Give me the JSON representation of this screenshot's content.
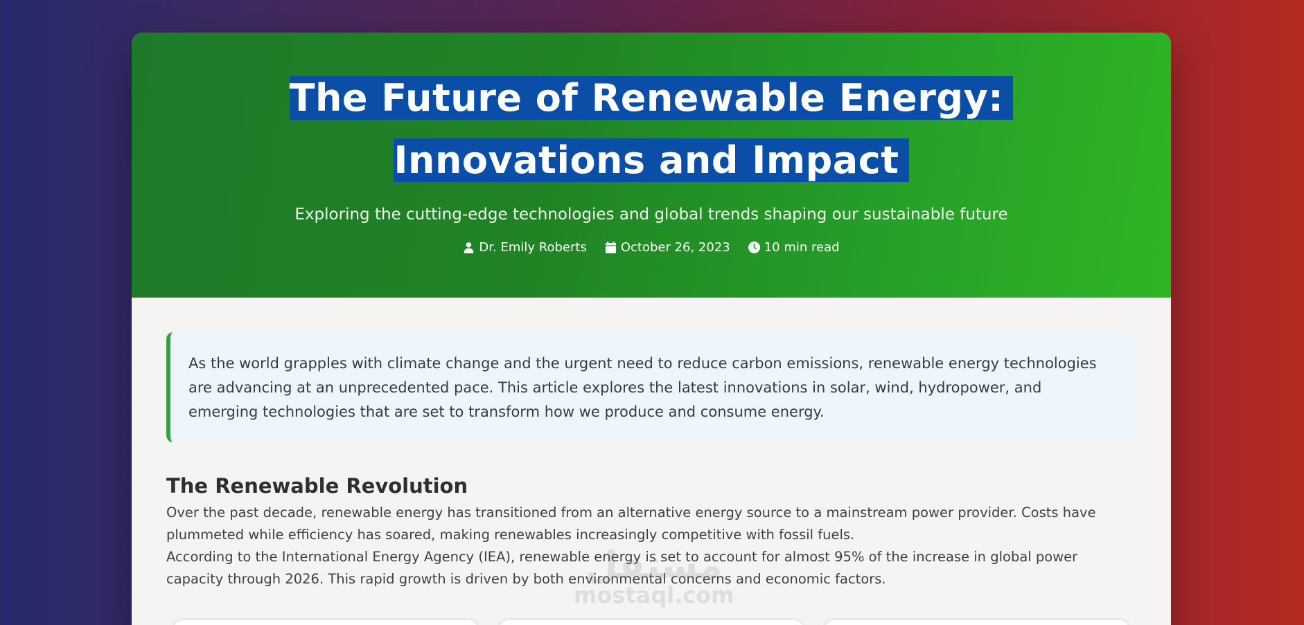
{
  "article": {
    "title": "The Future of Renewable Energy: Innovations and Impact",
    "subtitle": "Exploring the cutting-edge technologies and global trends shaping our sustainable future",
    "meta": {
      "author": "Dr. Emily Roberts",
      "date": "October 26, 2023",
      "read_time": "10 min read",
      "icons": [
        "user-icon",
        "calendar-icon",
        "clock-icon"
      ]
    },
    "intro": "As the world grapples with climate change and the urgent need to reduce carbon emissions, renewable energy technologies are advancing at an unprecedented pace. This article explores the latest innovations in solar, wind, hydropower, and emerging technologies that are set to transform how we produce and consume energy.",
    "sections": [
      {
        "heading": "The Renewable Revolution",
        "paragraphs": [
          "Over the past decade, renewable energy has transitioned from an alternative energy source to a mainstream power provider. Costs have plummeted while efficiency has soared, making renewables increasingly competitive with fossil fuels.",
          "According to the International Energy Agency (IEA), renewable energy is set to account for almost 95% of the increase in global power capacity through 2026. This rapid growth is driven by both environmental concerns and economic factors."
        ]
      }
    ]
  },
  "watermark": {
    "arabic": "مستقل",
    "latin": "mostaql.com"
  },
  "colors": {
    "header_green": "#208325",
    "title_highlight": "#0a4ea8",
    "intro_border": "#2ea63a",
    "intro_bg": "#eef6fd"
  }
}
